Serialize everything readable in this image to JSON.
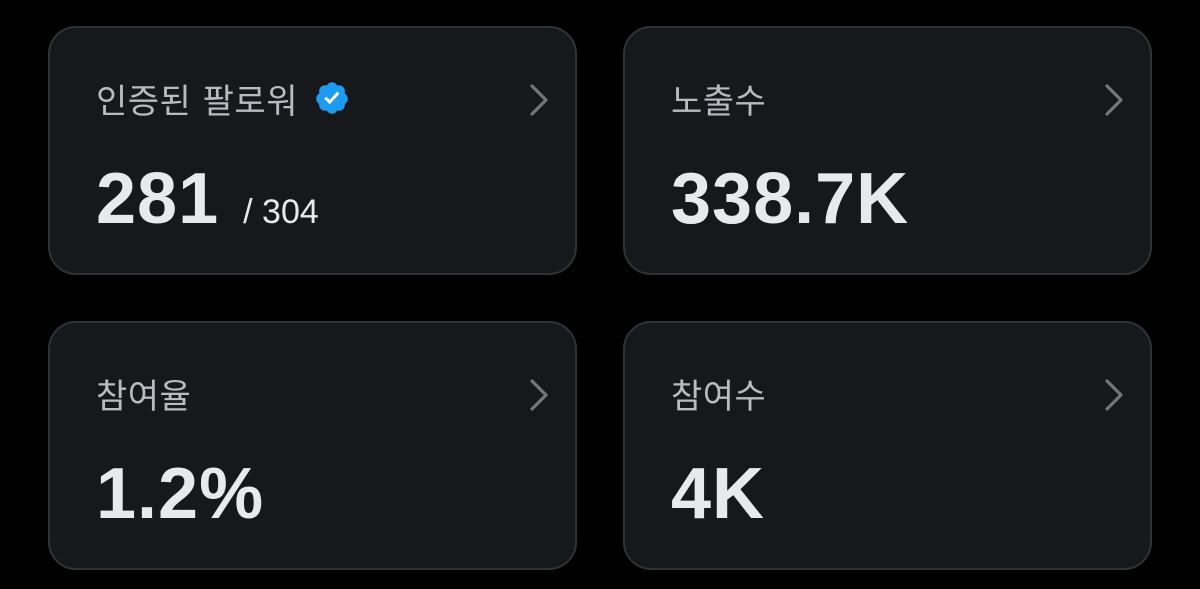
{
  "colors": {
    "background": "#000000",
    "card_background": "#16181c",
    "card_border": "#2f3336",
    "title_text": "#b8bcc1",
    "value_text": "#e7e9ea",
    "verified_badge": "#1d9bf0"
  },
  "cards": [
    {
      "title": "인증된 팔로워",
      "icon": "verified-badge-icon",
      "value": "281",
      "total": "/ 304",
      "chevron_icon": "chevron-right-icon"
    },
    {
      "title": "노출수",
      "value": "338.7K",
      "chevron_icon": "chevron-right-icon"
    },
    {
      "title": "참여율",
      "value": "1.2%",
      "chevron_icon": "chevron-right-icon"
    },
    {
      "title": "참여수",
      "value": "4K",
      "chevron_icon": "chevron-right-icon"
    }
  ]
}
